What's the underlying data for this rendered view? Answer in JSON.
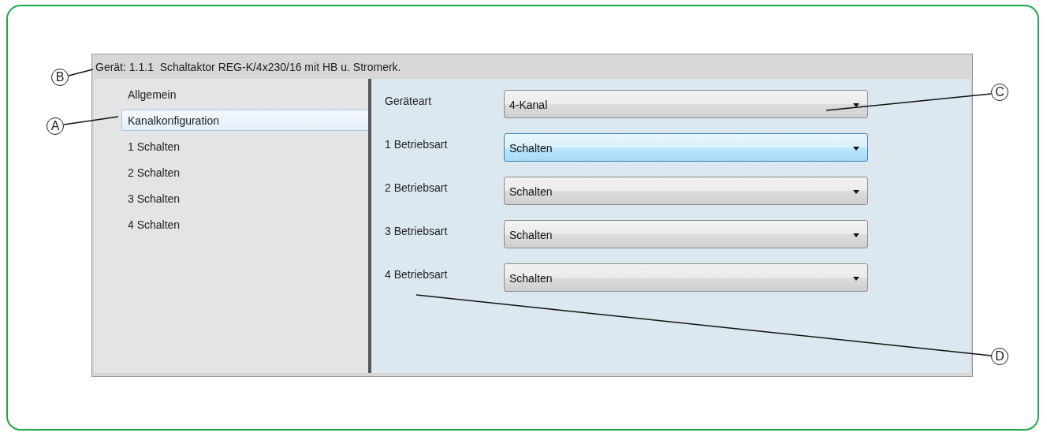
{
  "window": {
    "title": "Gerät: 1.1.1  Schaltaktor REG-K/4x230/16 mit HB u. Stromerk."
  },
  "sidebar": {
    "items": [
      {
        "label": "Allgemein",
        "selected": false
      },
      {
        "label": "Kanalkonfiguration",
        "selected": true
      },
      {
        "label": "1 Schalten",
        "selected": false
      },
      {
        "label": "2 Schalten",
        "selected": false
      },
      {
        "label": "3 Schalten",
        "selected": false
      },
      {
        "label": "4 Schalten",
        "selected": false
      }
    ]
  },
  "parameters": [
    {
      "label": "Geräteart",
      "value": "4-Kanal",
      "highlighted": false
    },
    {
      "label": "1 Betriebsart",
      "value": "Schalten",
      "highlighted": true
    },
    {
      "label": "2 Betriebsart",
      "value": "Schalten",
      "highlighted": false
    },
    {
      "label": "3 Betriebsart",
      "value": "Schalten",
      "highlighted": false
    },
    {
      "label": "4 Betriebsart",
      "value": "Schalten",
      "highlighted": false
    }
  ],
  "callouts": [
    {
      "label": "A"
    },
    {
      "label": "B"
    },
    {
      "label": "C"
    },
    {
      "label": "D"
    }
  ]
}
